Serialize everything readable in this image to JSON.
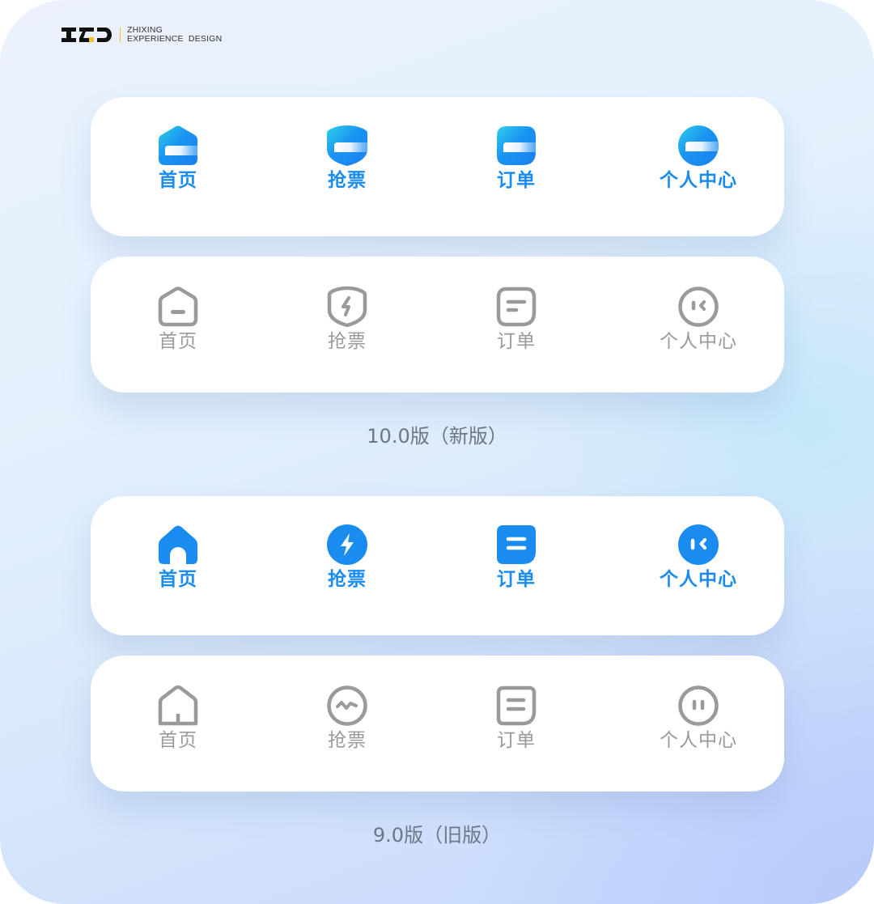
{
  "logo": {
    "mark": "ZXD",
    "line1": "ZHIXING",
    "line2": "EXPERIENCE  DESIGN"
  },
  "colors": {
    "active_blue": "#1a8cf0",
    "inactive_gray": "#9a9a9a",
    "logo_accent": "#f2c230",
    "caption": "#6b7786"
  },
  "versions": [
    {
      "caption": "10.0版（新版）",
      "selected_bar": {
        "state": "selected",
        "tabs": [
          {
            "label": "首页",
            "icon": "home-gradient-icon"
          },
          {
            "label": "抢票",
            "icon": "shield-gradient-icon"
          },
          {
            "label": "订单",
            "icon": "order-gradient-icon"
          },
          {
            "label": "个人中心",
            "icon": "profile-gradient-icon"
          }
        ]
      },
      "unselected_bar": {
        "state": "unselected",
        "tabs": [
          {
            "label": "首页",
            "icon": "home-outline-icon"
          },
          {
            "label": "抢票",
            "icon": "shield-lightning-outline-icon"
          },
          {
            "label": "订单",
            "icon": "order-outline-icon"
          },
          {
            "label": "个人中心",
            "icon": "face-outline-icon"
          }
        ]
      }
    },
    {
      "caption": "9.0版（旧版）",
      "selected_bar": {
        "state": "selected",
        "tabs": [
          {
            "label": "首页",
            "icon": "home-filled-icon"
          },
          {
            "label": "抢票",
            "icon": "lightning-filled-icon"
          },
          {
            "label": "订单",
            "icon": "order-filled-icon"
          },
          {
            "label": "个人中心",
            "icon": "face-filled-icon"
          }
        ]
      },
      "unselected_bar": {
        "state": "unselected",
        "tabs": [
          {
            "label": "首页",
            "icon": "home-outline-icon"
          },
          {
            "label": "抢票",
            "icon": "pulse-outline-icon"
          },
          {
            "label": "订单",
            "icon": "order-outline-icon"
          },
          {
            "label": "个人中心",
            "icon": "face-outline-icon"
          }
        ]
      }
    }
  ]
}
